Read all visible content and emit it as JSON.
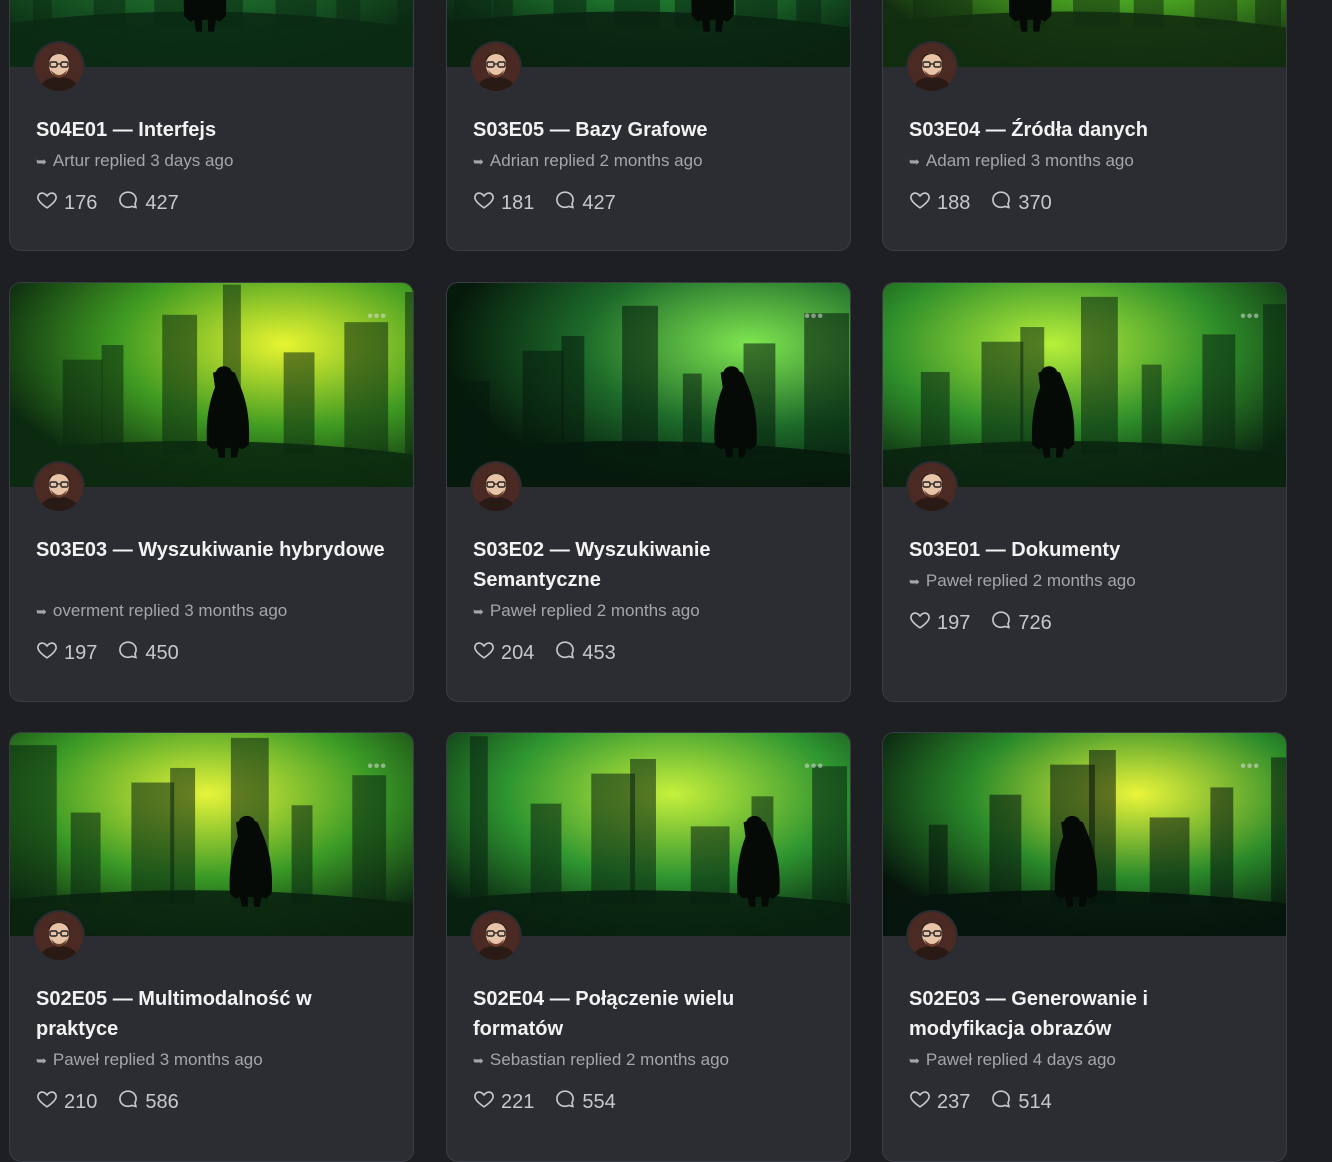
{
  "cards": [
    {
      "title": "S04E01 — Interfejs",
      "reply": "Artur replied 3 days ago",
      "likes": "176",
      "comments": "427",
      "palette": [
        "#0b2a14",
        "#1c6b2a",
        "#5fd13c"
      ]
    },
    {
      "title": "S03E05 — Bazy Grafowe",
      "reply": "Adrian replied 2 months ago",
      "likes": "181",
      "comments": "427",
      "palette": [
        "#0a2412",
        "#1f7a2e",
        "#6ee244"
      ]
    },
    {
      "title": "S03E04 — Źródła danych",
      "reply": "Adam replied 3 months ago",
      "likes": "188",
      "comments": "370",
      "palette": [
        "#122e10",
        "#4caa22",
        "#d9f23a"
      ]
    },
    {
      "title": "S03E03 — Wyszukiwanie hybrydowe",
      "reply": "overment replied 3 months ago",
      "likes": "197",
      "comments": "450",
      "palette": [
        "#0c2a10",
        "#3f9b22",
        "#e8f531"
      ]
    },
    {
      "title": "S03E02 — Wyszukiwanie Semantyczne",
      "reply": "Paweł replied 2 months ago",
      "likes": "204",
      "comments": "453",
      "palette": [
        "#061a0c",
        "#1d6a2a",
        "#7fe650"
      ]
    },
    {
      "title": "S03E01 — Dokumenty",
      "reply": "Paweł replied 2 months ago",
      "likes": "197",
      "comments": "726",
      "palette": [
        "#0a2410",
        "#2f8f2a",
        "#b8f03a"
      ]
    },
    {
      "title": "S02E05 — Multimodalność w praktyce",
      "reply": "Paweł replied 3 months ago",
      "likes": "210",
      "comments": "586",
      "palette": [
        "#0a2410",
        "#3a9a26",
        "#e6f43a"
      ]
    },
    {
      "title": "S02E04 — Połączenie wielu formatów",
      "reply": "Sebastian replied 2 months ago",
      "likes": "221",
      "comments": "554",
      "palette": [
        "#082010",
        "#2e9530",
        "#c6f03c"
      ]
    },
    {
      "title": "S02E03 — Generowanie i modyfikacja obrazów",
      "reply": "Paweł replied 4 days ago",
      "likes": "237",
      "comments": "514",
      "palette": [
        "#06140c",
        "#2a8a2a",
        "#eaf53a"
      ]
    }
  ],
  "icons": {
    "like": "heart-icon",
    "comment": "comment-bubble-icon",
    "reply": "reply-arrow-icon",
    "more": "more-dots-icon"
  },
  "colors": {
    "background": "#1d1f23",
    "card": "#2b2d32",
    "text": "#f2f2f2",
    "muted": "#a4a6ab"
  }
}
